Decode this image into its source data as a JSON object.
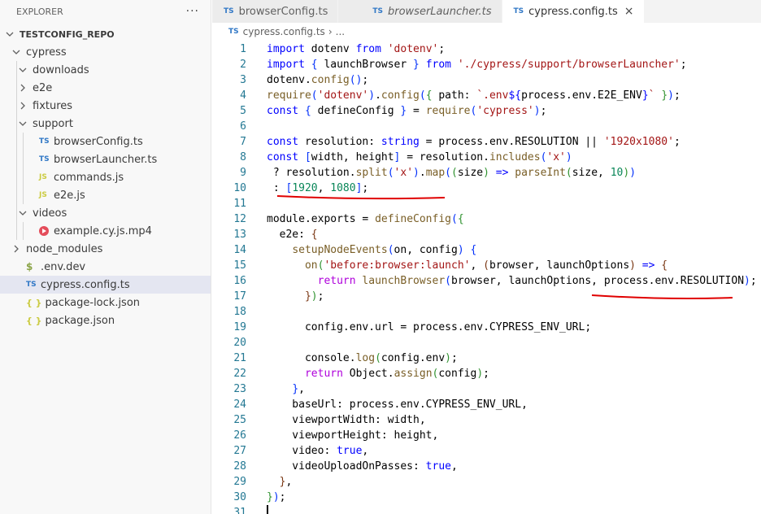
{
  "sidebar": {
    "header": "EXPLORER",
    "more": "···",
    "tree": [
      {
        "label": "TESTCONFIG_REPO",
        "kind": "root",
        "chevron": "down",
        "depth": 0
      },
      {
        "label": "cypress",
        "kind": "folder",
        "chevron": "down",
        "depth": 1
      },
      {
        "label": "downloads",
        "kind": "folder",
        "chevron": "down",
        "depth": 2
      },
      {
        "label": "e2e",
        "kind": "folder",
        "chevron": "right",
        "depth": 2
      },
      {
        "label": "fixtures",
        "kind": "folder",
        "chevron": "right",
        "depth": 2
      },
      {
        "label": "support",
        "kind": "folder",
        "chevron": "down",
        "depth": 2
      },
      {
        "label": "browserConfig.ts",
        "kind": "ts",
        "badge": "TS",
        "depth": 3
      },
      {
        "label": "browserLauncher.ts",
        "kind": "ts",
        "badge": "TS",
        "depth": 3
      },
      {
        "label": "commands.js",
        "kind": "js",
        "badge": "JS",
        "depth": 3
      },
      {
        "label": "e2e.js",
        "kind": "js",
        "badge": "JS",
        "depth": 3
      },
      {
        "label": "videos",
        "kind": "folder",
        "chevron": "down",
        "depth": 2
      },
      {
        "label": "example.cy.js.mp4",
        "kind": "mp4",
        "depth": 3
      },
      {
        "label": "node_modules",
        "kind": "folder",
        "chevron": "right",
        "depth": 1
      },
      {
        "label": ".env.dev",
        "kind": "env",
        "badge": "$",
        "depth": 1
      },
      {
        "label": "cypress.config.ts",
        "kind": "ts",
        "badge": "TS",
        "depth": 1,
        "selected": true
      },
      {
        "label": "package-lock.json",
        "kind": "json",
        "badge": "{ }",
        "depth": 1
      },
      {
        "label": "package.json",
        "kind": "json",
        "badge": "{ }",
        "depth": 1
      }
    ]
  },
  "tabs": [
    {
      "badge": "TS",
      "label": "browserConfig.ts",
      "active": false,
      "italic": false
    },
    {
      "badge": "TS",
      "label": "browserLauncher.ts",
      "active": false,
      "italic": true
    },
    {
      "badge": "TS",
      "label": "cypress.config.ts",
      "active": true,
      "italic": false,
      "close": "×"
    }
  ],
  "breadcrumb": {
    "badge": "TS",
    "file": "cypress.config.ts",
    "sep": "›",
    "rest": "..."
  },
  "editor": {
    "lines": [
      [
        [
          "kw",
          "import"
        ],
        [
          "",
          " dotenv "
        ],
        [
          "kw",
          "from"
        ],
        [
          "str",
          " 'dotenv'"
        ],
        [
          "",
          ";"
        ]
      ],
      [
        [
          "kw",
          "import"
        ],
        [
          "",
          " "
        ],
        [
          "br1",
          "{"
        ],
        [
          "",
          " launchBrowser "
        ],
        [
          "br1",
          "}"
        ],
        [
          "",
          " "
        ],
        [
          "kw",
          "from"
        ],
        [
          "str",
          " './cypress/support/browserLauncher'"
        ],
        [
          "",
          ";"
        ]
      ],
      [
        [
          "",
          "dotenv."
        ],
        [
          "fn",
          "config"
        ],
        [
          "br1",
          "()"
        ],
        [
          "",
          ";"
        ]
      ],
      [
        [
          "fn",
          "require"
        ],
        [
          "br1",
          "("
        ],
        [
          "str",
          "'dotenv'"
        ],
        [
          "br1",
          ")"
        ],
        [
          "",
          "."
        ],
        [
          "fn",
          "config"
        ],
        [
          "br1",
          "("
        ],
        [
          "br2",
          "{"
        ],
        [
          "",
          " path: "
        ],
        [
          "str",
          "`.env"
        ],
        [
          "kw",
          "${"
        ],
        [
          "",
          "process.env.E2E_ENV"
        ],
        [
          "kw",
          "}"
        ],
        [
          "str",
          "`"
        ],
        [
          "",
          " "
        ],
        [
          "br2",
          "}"
        ],
        [
          "br1",
          ")"
        ],
        [
          "",
          ";"
        ]
      ],
      [
        [
          "kw",
          "const"
        ],
        [
          "",
          " "
        ],
        [
          "br1",
          "{"
        ],
        [
          "",
          " defineConfig "
        ],
        [
          "br1",
          "}"
        ],
        [
          "",
          " = "
        ],
        [
          "fn",
          "require"
        ],
        [
          "br1",
          "("
        ],
        [
          "str",
          "'cypress'"
        ],
        [
          "br1",
          ")"
        ],
        [
          "",
          ";"
        ]
      ],
      [],
      [
        [
          "kw",
          "const"
        ],
        [
          "",
          " resolution: "
        ],
        [
          "kw",
          "string"
        ],
        [
          "",
          " = process.env.RESOLUTION || "
        ],
        [
          "str",
          "'1920x1080'"
        ],
        [
          "",
          ";"
        ]
      ],
      [
        [
          "kw",
          "const"
        ],
        [
          "",
          " "
        ],
        [
          "br1",
          "["
        ],
        [
          "",
          "width, height"
        ],
        [
          "br1",
          "]"
        ],
        [
          "",
          " = resolution."
        ],
        [
          "fn",
          "includes"
        ],
        [
          "br1",
          "("
        ],
        [
          "str",
          "'x'"
        ],
        [
          "br1",
          ")"
        ]
      ],
      [
        [
          "",
          " ? resolution."
        ],
        [
          "fn",
          "split"
        ],
        [
          "br1",
          "("
        ],
        [
          "str",
          "'x'"
        ],
        [
          "br1",
          ")"
        ],
        [
          "",
          "."
        ],
        [
          "fn",
          "map"
        ],
        [
          "br1",
          "("
        ],
        [
          "br2",
          "("
        ],
        [
          "",
          "size"
        ],
        [
          "br2",
          ")"
        ],
        [
          "",
          " "
        ],
        [
          "kw",
          "=>"
        ],
        [
          "",
          " "
        ],
        [
          "fn",
          "parseInt"
        ],
        [
          "br2",
          "("
        ],
        [
          "",
          "size, "
        ],
        [
          "num",
          "10"
        ],
        [
          "br2",
          ")"
        ],
        [
          "br1",
          ")"
        ]
      ],
      [
        [
          "",
          " : "
        ],
        [
          "br1",
          "["
        ],
        [
          "num",
          "1920"
        ],
        [
          "",
          ", "
        ],
        [
          "num",
          "1080"
        ],
        [
          "br1",
          "]"
        ],
        [
          "",
          ";"
        ]
      ],
      [],
      [
        [
          "",
          "module.exports = "
        ],
        [
          "fn",
          "defineConfig"
        ],
        [
          "br1",
          "("
        ],
        [
          "br2",
          "{"
        ]
      ],
      [
        [
          "",
          "  e2e: "
        ],
        [
          "br3",
          "{"
        ]
      ],
      [
        [
          "",
          "    "
        ],
        [
          "fn",
          "setupNodeEvents"
        ],
        [
          "br1",
          "("
        ],
        [
          "",
          "on, config"
        ],
        [
          "br1",
          ")"
        ],
        [
          "",
          " "
        ],
        [
          "br1",
          "{"
        ]
      ],
      [
        [
          "",
          "      "
        ],
        [
          "fn",
          "on"
        ],
        [
          "br2",
          "("
        ],
        [
          "str",
          "'before:browser:launch'"
        ],
        [
          "",
          ", "
        ],
        [
          "br3",
          "("
        ],
        [
          "",
          "browser, launchOptions"
        ],
        [
          "br3",
          ")"
        ],
        [
          "",
          " "
        ],
        [
          "kw",
          "=>"
        ],
        [
          "",
          " "
        ],
        [
          "br3",
          "{"
        ]
      ],
      [
        [
          "",
          "        "
        ],
        [
          "kw2",
          "return"
        ],
        [
          "",
          " "
        ],
        [
          "fn",
          "launchBrowser"
        ],
        [
          "br1",
          "("
        ],
        [
          "",
          "browser, launchOptions, process.env.RESOLUTION"
        ],
        [
          "br1",
          ")"
        ],
        [
          "",
          ";"
        ]
      ],
      [
        [
          "",
          "      "
        ],
        [
          "br3",
          "}"
        ],
        [
          "br2",
          ")"
        ],
        [
          "",
          ";"
        ]
      ],
      [],
      [
        [
          "",
          "      config.env.url = process.env.CYPRESS_ENV_URL;"
        ]
      ],
      [],
      [
        [
          "",
          "      console."
        ],
        [
          "fn",
          "log"
        ],
        [
          "br2",
          "("
        ],
        [
          "",
          "config.env"
        ],
        [
          "br2",
          ")"
        ],
        [
          "",
          ";"
        ]
      ],
      [
        [
          "",
          "      "
        ],
        [
          "kw2",
          "return"
        ],
        [
          "",
          " Object."
        ],
        [
          "fn",
          "assign"
        ],
        [
          "br2",
          "("
        ],
        [
          "",
          "config"
        ],
        [
          "br2",
          ")"
        ],
        [
          "",
          ";"
        ]
      ],
      [
        [
          "",
          "    "
        ],
        [
          "br1",
          "}"
        ],
        [
          "",
          ","
        ]
      ],
      [
        [
          "",
          "    baseUrl: process.env.CYPRESS_ENV_URL,"
        ]
      ],
      [
        [
          "",
          "    viewportWidth: width,"
        ]
      ],
      [
        [
          "",
          "    viewportHeight: height,"
        ]
      ],
      [
        [
          "",
          "    video: "
        ],
        [
          "kw",
          "true"
        ],
        [
          "",
          ","
        ]
      ],
      [
        [
          "",
          "    videoUploadOnPasses: "
        ],
        [
          "kw",
          "true"
        ],
        [
          "",
          ","
        ]
      ],
      [
        [
          "",
          "  "
        ],
        [
          "br3",
          "}"
        ],
        [
          "",
          ","
        ]
      ],
      [
        [
          "br2",
          "}"
        ],
        [
          "br1",
          ")"
        ],
        [
          "",
          ";"
        ]
      ],
      []
    ],
    "annotation_color": "#e00000"
  }
}
